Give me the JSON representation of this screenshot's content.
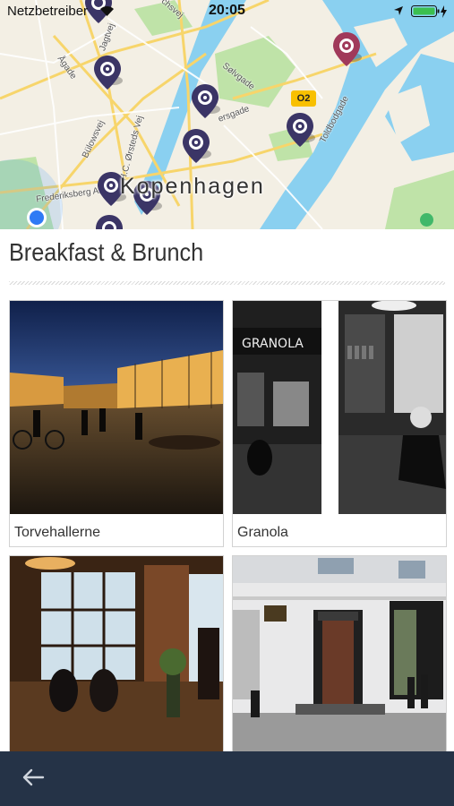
{
  "status_bar": {
    "carrier": "Netzbetreiber",
    "time": "20:05"
  },
  "map": {
    "city_label": "Kopenhagen",
    "metro_badge": "O2",
    "streets": [
      "Ågade",
      "Jagtvej",
      "Bülowsvej",
      "H.C. Ørsteds Vej",
      "Frederiksberg Allé",
      "Sølvgade",
      "ersgade",
      "Toldbodgade",
      "chsvej"
    ]
  },
  "section": {
    "title": "Breakfast & Brunch"
  },
  "places": [
    {
      "name": "Torvehallerne"
    },
    {
      "name": "Granola"
    },
    {
      "name": ""
    },
    {
      "name": ""
    }
  ],
  "nav": {
    "back_icon": "back-arrow-icon"
  },
  "colors": {
    "bottom_bar": "#253347",
    "pin": "#3b3566",
    "pin_highlight": "#a0395a"
  }
}
